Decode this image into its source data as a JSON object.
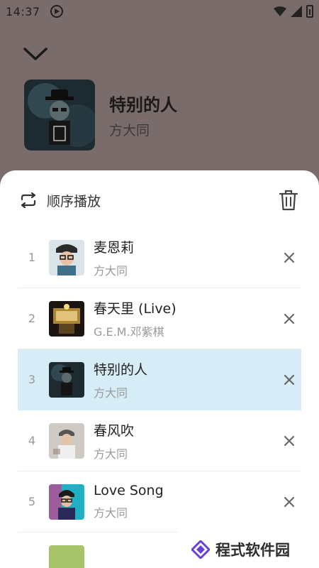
{
  "status": {
    "time": "14:37"
  },
  "now_playing": {
    "title": "特别的人",
    "artist": "方大同"
  },
  "queue": {
    "mode_label": "顺序播放",
    "items": [
      {
        "index": "1",
        "title": "麦恩莉",
        "artist": "方大同"
      },
      {
        "index": "2",
        "title": "春天里 (Live)",
        "artist": "G.E.M.邓紫棋"
      },
      {
        "index": "3",
        "title": "特别的人",
        "artist": "方大同"
      },
      {
        "index": "4",
        "title": "春风吹",
        "artist": "方大同"
      },
      {
        "index": "5",
        "title": "Love Song",
        "artist": "方大同"
      }
    ],
    "active_index": 3
  },
  "watermark": {
    "text": "程式软件园"
  },
  "colors": {
    "active_row_bg": "#d6ecf6",
    "backdrop": "#7a6c6b",
    "accent": "#6a3fd6"
  }
}
